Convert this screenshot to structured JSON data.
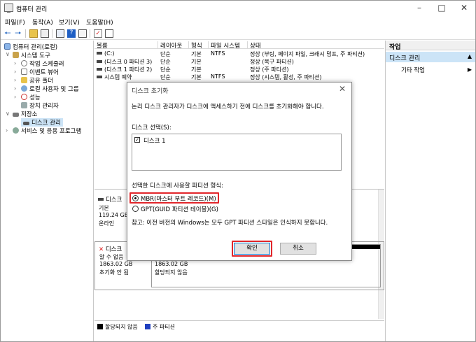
{
  "window": {
    "title": "컴퓨터 관리"
  },
  "menu": [
    "파일(F)",
    "동작(A)",
    "보기(V)",
    "도움말(H)"
  ],
  "tree": {
    "root": "컴퓨터 관리(로컬)",
    "system_tools": "시스템 도구",
    "task_scheduler": "작업 스케줄러",
    "event_viewer": "이벤트 뷰어",
    "shared_folders": "공유 폴더",
    "local_users": "로컬 사용자 및 그룹",
    "performance": "성능",
    "device_manager": "장치 관리자",
    "storage": "저장소",
    "disk_management": "디스크 관리",
    "services": "서비스 및 응용 프로그램"
  },
  "grid": {
    "headers": [
      "볼륨",
      "레이아웃",
      "형식",
      "파일 시스템",
      "상태"
    ],
    "rows": [
      [
        "(C:)",
        "단순",
        "기본",
        "NTFS",
        "정상 (부팅, 페이지 파일, 크래시 덤프, 주 파티션)"
      ],
      [
        "(디스크 0 파티션 3)",
        "단순",
        "기본",
        "",
        "정상 (복구 파티션)"
      ],
      [
        "(디스크 1 파티션 2)",
        "단순",
        "기본",
        "",
        "정상 (주 파티션)"
      ],
      [
        "시스템 예약",
        "단순",
        "기본",
        "NTFS",
        "정상 (시스템, 활성, 주 파티션)"
      ]
    ]
  },
  "lower": {
    "disk0": {
      "label": "디스크",
      "type": "기본",
      "size": "119.24 GB",
      "state": "온라인"
    },
    "disk1": {
      "label": "디스크",
      "type": "알 수 없음",
      "size": "1863.02 GB",
      "state": "초기화 안 됨"
    },
    "unalloc": {
      "size": "1863.02 GB",
      "state": "할당되지 않음"
    }
  },
  "legend": {
    "unalloc": "할당되지 않음",
    "primary": "주 파티션"
  },
  "actions": {
    "header": "작업",
    "selected": "디스크 관리",
    "more": "기타 작업"
  },
  "dialog": {
    "title": "디스크 초기화",
    "intro": "논리 디스크 관리자가 디스크에 액세스하기 전에 디스크를 초기화해야 합니다.",
    "select_label": "디스크 선택(S):",
    "disk_item": "디스크 1",
    "style_label": "선택한 디스크에 사용할 파티션 형식:",
    "mbr": "MBR(마스터 부트 레코드)(M)",
    "gpt": "GPT(GUID 파티션 테이블)(G)",
    "note": "참고: 이전 버전의 Windows는 모두 GPT 파티션 스타일은 인식하지 못합니다.",
    "ok": "확인",
    "cancel": "취소"
  },
  "colors": {
    "accent": "#0078d7",
    "highlight": "#e2262b",
    "selection": "#cce4f7",
    "unalloc": "#000000",
    "primary": "#1f3fbf"
  }
}
